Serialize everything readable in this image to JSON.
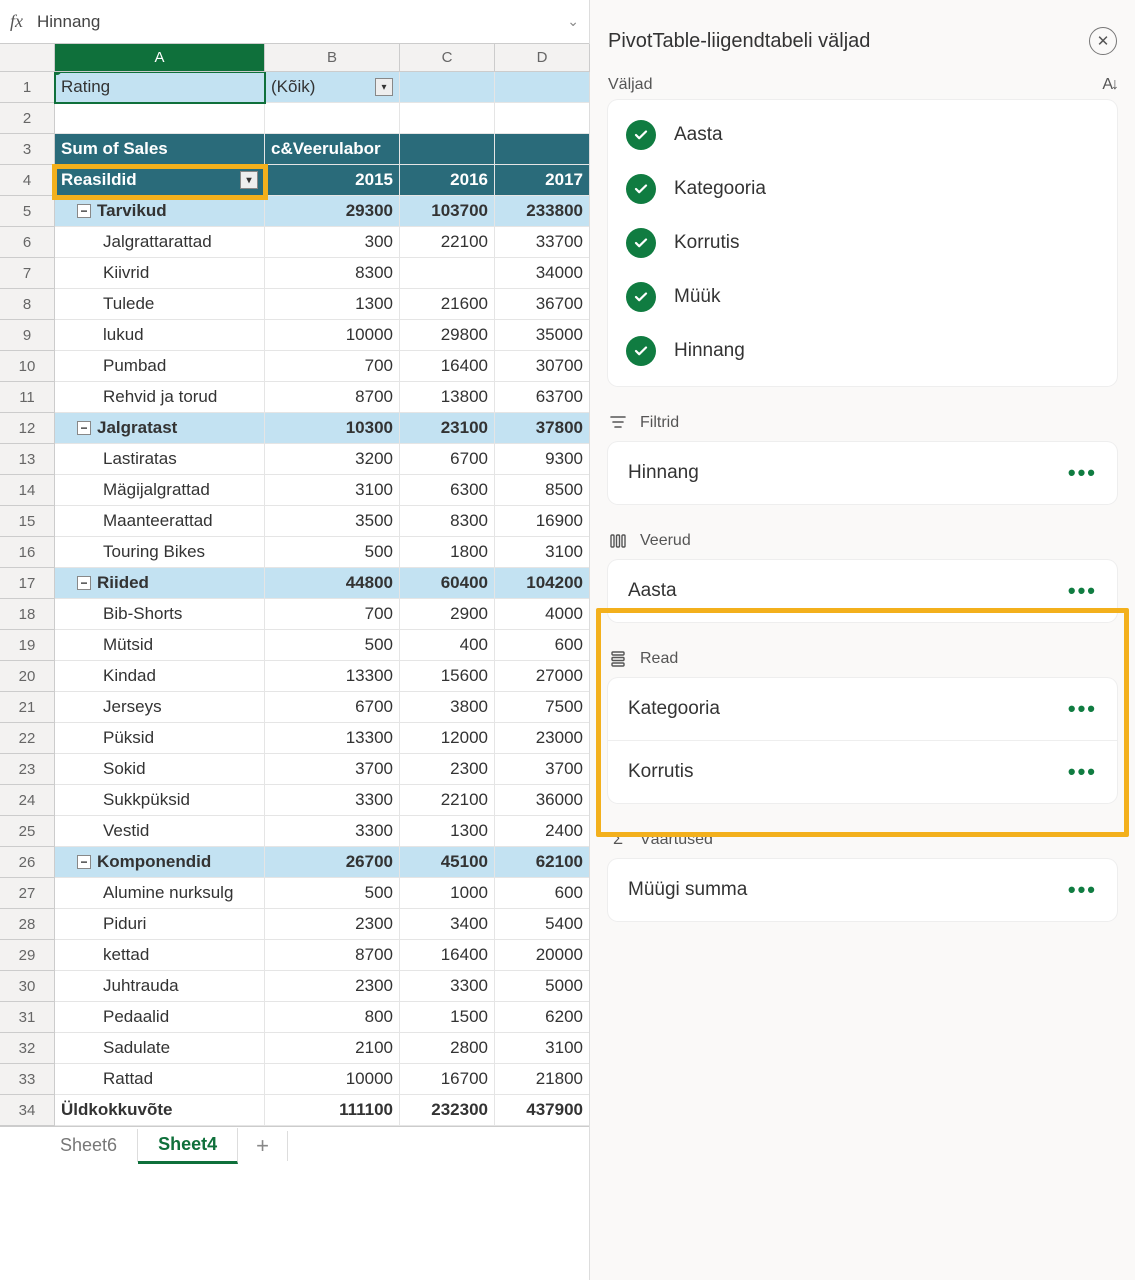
{
  "formula_bar": {
    "value": "Hinnang"
  },
  "columns": [
    "A",
    "B",
    "C",
    "D"
  ],
  "row_numbers": [
    1,
    2,
    3,
    4,
    5,
    6,
    7,
    8,
    9,
    10,
    11,
    12,
    13,
    14,
    15,
    16,
    17,
    18,
    19,
    20,
    21,
    22,
    23,
    24,
    25,
    26,
    27,
    28,
    29,
    30,
    31,
    32,
    33,
    34
  ],
  "pivot": {
    "filter_label": "Rating",
    "filter_value": "(Kõik)",
    "values_label": "Sum of Sales",
    "col_label": "c&amp;Veerulabor",
    "row_label": "Reasildid",
    "years": [
      "2015",
      "2016",
      "2017"
    ],
    "groups": [
      {
        "name": "Tarvikud",
        "totals": [
          "29300",
          "103700",
          "233800"
        ],
        "rows": [
          {
            "name": "Jalgrattarattad",
            "v": [
              "300",
              "22100",
              "33700"
            ]
          },
          {
            "name": "Kiivrid",
            "v": [
              "8300",
              "",
              "34000"
            ]
          },
          {
            "name": "Tulede",
            "v": [
              "1300",
              "21600",
              "36700"
            ]
          },
          {
            "name": "lukud",
            "v": [
              "10000",
              "29800",
              "35000"
            ]
          },
          {
            "name": "Pumbad",
            "v": [
              "700",
              "16400",
              "30700"
            ]
          },
          {
            "name": "Rehvid ja torud",
            "v": [
              "8700",
              "13800",
              "63700"
            ]
          }
        ]
      },
      {
        "name": "Jalgratast",
        "totals": [
          "10300",
          "23100",
          "37800"
        ],
        "rows": [
          {
            "name": "Lastiratas",
            "v": [
              "3200",
              "6700",
              "9300"
            ]
          },
          {
            "name": "Mägijalgrattad",
            "v": [
              "3100",
              "6300",
              "8500"
            ]
          },
          {
            "name": "Maanteerattad",
            "v": [
              "3500",
              "8300",
              "16900"
            ]
          },
          {
            "name": "Touring Bikes",
            "v": [
              "500",
              "1800",
              "3100"
            ]
          }
        ]
      },
      {
        "name": "Riided",
        "totals": [
          "44800",
          "60400",
          "104200"
        ],
        "rows": [
          {
            "name": "Bib-Shorts",
            "v": [
              "700",
              "2900",
              "4000"
            ]
          },
          {
            "name": "Mütsid",
            "v": [
              "500",
              "400",
              "600"
            ]
          },
          {
            "name": "Kindad",
            "v": [
              "13300",
              "15600",
              "27000"
            ]
          },
          {
            "name": "Jerseys",
            "v": [
              "6700",
              "3800",
              "7500"
            ]
          },
          {
            "name": "Püksid",
            "v": [
              "13300",
              "12000",
              "23000"
            ]
          },
          {
            "name": "Sokid",
            "v": [
              "3700",
              "2300",
              "3700"
            ]
          },
          {
            "name": "Sukkpüksid",
            "v": [
              "3300",
              "22100",
              "36000"
            ]
          },
          {
            "name": "Vestid",
            "v": [
              "3300",
              "1300",
              "2400"
            ]
          }
        ]
      },
      {
        "name": "Komponendid",
        "totals": [
          "26700",
          "45100",
          "62100"
        ],
        "rows": [
          {
            "name": "Alumine nurksulg",
            "v": [
              "500",
              "1000",
              "600"
            ]
          },
          {
            "name": "Piduri",
            "v": [
              "2300",
              "3400",
              "5400"
            ]
          },
          {
            "name": "kettad",
            "v": [
              "8700",
              "16400",
              "20000"
            ]
          },
          {
            "name": "Juhtrauda",
            "v": [
              "2300",
              "3300",
              "5000"
            ]
          },
          {
            "name": "Pedaalid",
            "v": [
              "800",
              "1500",
              "6200"
            ]
          },
          {
            "name": "Sadulate",
            "v": [
              "2100",
              "2800",
              "3100"
            ]
          },
          {
            "name": "Rattad",
            "v": [
              "10000",
              "16700",
              "21800"
            ]
          }
        ]
      }
    ],
    "grand_label": "Üldkokkuvõte",
    "grand": [
      "111100",
      "232300",
      "437900"
    ]
  },
  "tabs": {
    "list": [
      "Sheet6",
      "Sheet4"
    ],
    "active": "Sheet4"
  },
  "panel": {
    "title": "PivotTable-liigendtabeli väljad",
    "fields_label": "Väljad",
    "fields": [
      "Aasta",
      "Kategooria",
      "Korrutis",
      "Müük",
      "Hinnang"
    ],
    "sections": {
      "filters": {
        "label": "Filtrid",
        "items": [
          "Hinnang"
        ]
      },
      "columns": {
        "label": "Veerud",
        "items": [
          "Aasta"
        ]
      },
      "rows": {
        "label": "Read",
        "items": [
          "Kategooria",
          "Korrutis"
        ]
      },
      "values": {
        "label": "Väärtused",
        "items": [
          "Müügi summa"
        ]
      }
    }
  }
}
